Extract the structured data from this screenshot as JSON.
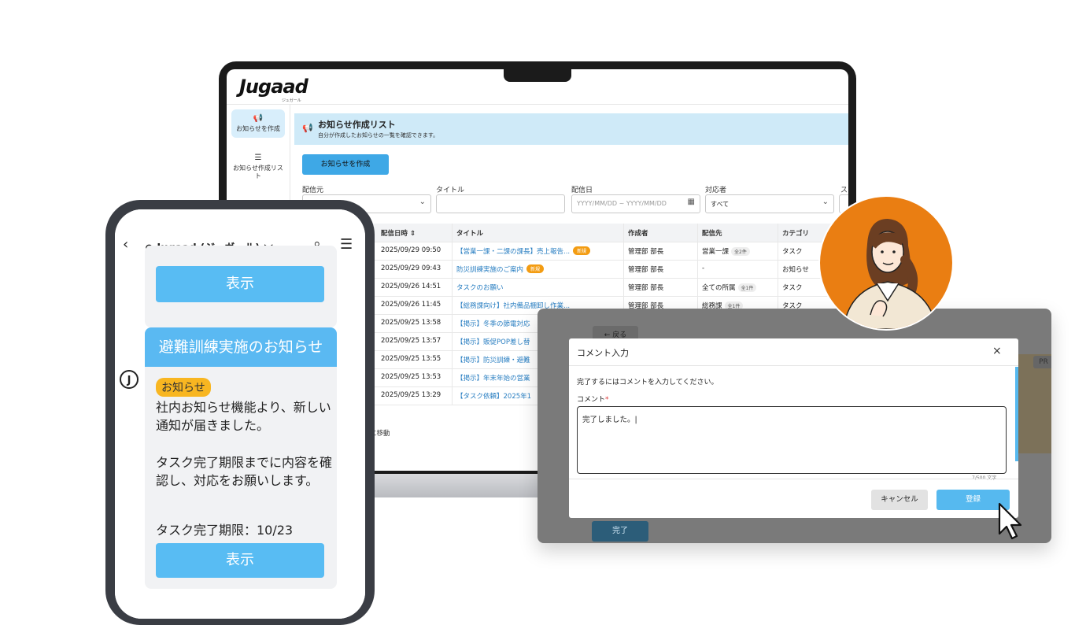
{
  "laptop": {
    "brand": "Jugaad",
    "brand_sub": "ジュガール",
    "sidebar": [
      {
        "label": "お知らせを作成"
      },
      {
        "label": "お知らせ作成リスト"
      }
    ],
    "header_title": "お知らせ作成リスト",
    "header_subtitle": "自分が作成したお知らせの一覧を確認できます。",
    "create_button": "お知らせを作成",
    "filters": {
      "source_label": "配信元",
      "title_label": "タイトル",
      "date_label": "配信日",
      "date_placeholder": "YYYY/MM/DD ~ YYYY/MM/DD",
      "assignee_label": "対応者",
      "assignee_value": "すべて",
      "extra_label": "ス"
    },
    "table": {
      "headers": {
        "date": "配信日時 ⇕",
        "title": "タイトル",
        "author": "作成者",
        "dest": "配信先",
        "category": "カテゴリ"
      },
      "rows": [
        {
          "date": "2025/09/29 09:50",
          "title": "【営業一課・二課の課長】売上報告...",
          "badge": "新規",
          "author": "管理部 部長",
          "dest": "営業一課",
          "count": "全2件",
          "category": "タスク"
        },
        {
          "date": "2025/09/29 09:43",
          "title": "防災訓練実施のご案内",
          "badge": "新規",
          "author": "管理部 部長",
          "dest": "-",
          "count": "",
          "category": "お知らせ"
        },
        {
          "date": "2025/09/26 14:51",
          "title": "タスクのお願い",
          "badge": "",
          "author": "管理部 部長",
          "dest": "全ての所属",
          "count": "全1件",
          "category": "タスク"
        },
        {
          "date": "2025/09/26 11:45",
          "title": "【総務課向け】社内備品棚卸し作業...",
          "badge": "",
          "author": "管理部 部長",
          "dest": "総務課",
          "count": "全1件",
          "category": "タスク"
        },
        {
          "date": "2025/09/25 13:58",
          "title": "【掲示】冬季の節電対応",
          "badge": "",
          "author": "",
          "dest": "",
          "count": "",
          "category": ""
        },
        {
          "date": "2025/09/25 13:57",
          "title": "【掲示】販促POP差し替",
          "badge": "",
          "author": "",
          "dest": "",
          "count": "",
          "category": ""
        },
        {
          "date": "2025/09/25 13:55",
          "title": "【掲示】防災訓練・避難",
          "badge": "",
          "author": "",
          "dest": "",
          "count": "",
          "category": ""
        },
        {
          "date": "2025/09/25 13:53",
          "title": "【掲示】年末年始の営業",
          "badge": "",
          "author": "",
          "dest": "",
          "count": "",
          "category": ""
        },
        {
          "date": "2025/09/25 13:29",
          "title": "【タスク依頼】2025年1",
          "badge": "",
          "author": "",
          "dest": "",
          "count": "",
          "category": ""
        }
      ]
    },
    "move_text": "に移動"
  },
  "phone": {
    "chat_title": "Jugaad (ジュガール)",
    "top_button": "表示",
    "card_title": "避難訓練実施のお知らせ",
    "badge": "お知らせ",
    "msg1": "社内お知らせ機能より、新しい通知が届きました。",
    "msg2": "タスク完了期限までに内容を確認し、対応をお願いします。",
    "deadline": "タスク完了期限：10/23",
    "bottom_button": "表示"
  },
  "modal": {
    "back": "← 戻る",
    "pr": "PR",
    "done": "完了",
    "title": "コメント入力",
    "close": "×",
    "instruction": "完了するにはコメントを入力してください。",
    "comment_label": "コメント",
    "required_mark": "*",
    "comment_value": "完了しました。|",
    "counter": "7/500 文字",
    "cancel": "キャンセル",
    "submit": "登録"
  },
  "colors": {
    "accent": "#56b9ef",
    "orange": "#ea7e12",
    "badge_yellow": "#f8b621"
  }
}
